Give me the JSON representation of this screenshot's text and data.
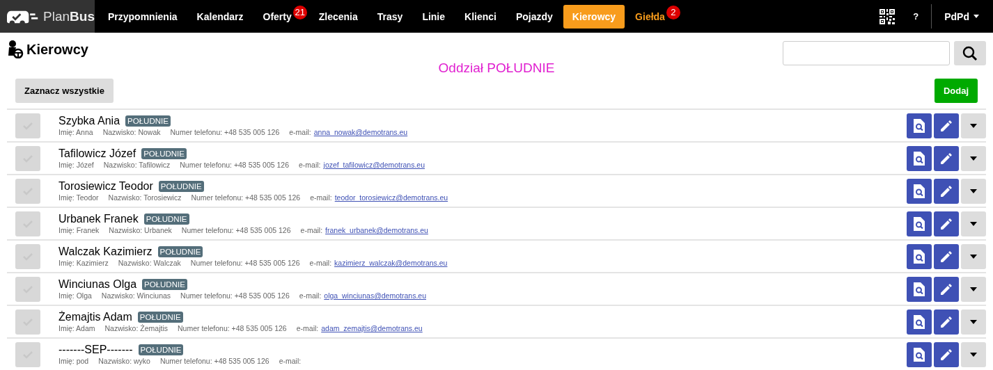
{
  "navbar": {
    "logo": "Plan",
    "logo_bold": "Bus",
    "items": [
      {
        "label": "Przypomnienia",
        "selected": false
      },
      {
        "label": "Kalendarz",
        "selected": false
      },
      {
        "label": "Oferty",
        "selected": false,
        "badge": "21"
      },
      {
        "label": "Zlecenia",
        "selected": false
      },
      {
        "label": "Trasy",
        "selected": false
      },
      {
        "label": "Linie",
        "selected": false
      },
      {
        "label": "Klienci",
        "selected": false
      },
      {
        "label": "Pojazdy",
        "selected": false
      },
      {
        "label": "Kierowcy",
        "selected": true
      },
      {
        "label": "Giełda",
        "selected": false,
        "highlight": true,
        "badge": "2"
      }
    ],
    "help": "?",
    "user": "PdPd"
  },
  "page": {
    "title": "Kierowcy",
    "branch": "Oddział POŁUDNIE",
    "select_all": "Zaznacz wszystkie",
    "add": "Dodaj"
  },
  "drivers": [
    {
      "name": "Szybka Ania",
      "tag": "POŁUDNIE",
      "first": "Imię: Anna",
      "last": "Nazwisko: Nowak",
      "phone": "Numer telefonu: +48 535 005 126",
      "email_label": "e-mail:",
      "email": "anna_nowak@demotrans.eu",
      "checked": false
    },
    {
      "name": "Tafilowicz Józef",
      "tag": "POŁUDNIE",
      "first": "Imię: Józef",
      "last": "Nazwisko: Tafilowicz",
      "phone": "Numer telefonu: +48 535 005 126",
      "email_label": "e-mail:",
      "email": "jozef_tafilowicz@demotrans.eu",
      "checked": false
    },
    {
      "name": "Torosiewicz Teodor",
      "tag": "POŁUDNIE",
      "first": "Imię: Teodor",
      "last": "Nazwisko: Torosiewicz",
      "phone": "Numer telefonu: +48 535 005 126",
      "email_label": "e-mail:",
      "email": "teodor_torosiewicz@demotrans.eu",
      "checked": false
    },
    {
      "name": "Urbanek Franek",
      "tag": "POŁUDNIE",
      "first": "Imię: Franek",
      "last": "Nazwisko: Urbanek",
      "phone": "Numer telefonu: +48 535 005 126",
      "email_label": "e-mail:",
      "email": "franek_urbanek@demotrans.eu",
      "checked": false
    },
    {
      "name": "Walczak Kazimierz",
      "tag": "POŁUDNIE",
      "first": "Imię: Kazimierz",
      "last": "Nazwisko: Walczak",
      "phone": "Numer telefonu: +48 535 005 126",
      "email_label": "e-mail:",
      "email": "kazimierz_walczak@demotrans.eu",
      "checked": false
    },
    {
      "name": "Winciunas Olga",
      "tag": "POŁUDNIE",
      "first": "Imię: Olga",
      "last": "Nazwisko: Winciunas",
      "phone": "Numer telefonu: +48 535 005 126",
      "email_label": "e-mail:",
      "email": "olga_winciunas@demotrans.eu",
      "checked": false
    },
    {
      "name": "Żemajtis Adam",
      "tag": "POŁUDNIE",
      "first": "Imię: Adam",
      "last": "Nazwisko: Żemajtis",
      "phone": "Numer telefonu: +48 535 005 126",
      "email_label": "e-mail:",
      "email": "adam_zemajtis@demotrans.eu",
      "checked": false
    },
    {
      "name": "-------SEP-------",
      "tag": "POŁUDNIE",
      "first": "Imię: pod",
      "last": "Nazwisko: wyko",
      "phone": "Numer telefonu: +48 535 005 126",
      "email_label": "e-mail:",
      "checked": false
    }
  ]
}
